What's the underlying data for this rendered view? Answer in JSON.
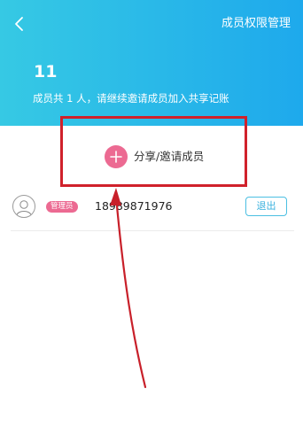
{
  "header": {
    "title": "成员权限管理",
    "member_count": "11",
    "summary": "成员共 1 人，请继续邀请成员加入共享记账"
  },
  "share": {
    "label": "分享/邀请成员"
  },
  "members": [
    {
      "role": "管理员",
      "phone": "18989871976",
      "action": "退出"
    }
  ],
  "icons": {
    "back": "chevron-left-icon",
    "add": "plus-icon",
    "avatar": "user-avatar-icon"
  },
  "colors": {
    "header_gradient_start": "#36c9e4",
    "header_gradient_end": "#1ea9ec",
    "accent_pink": "#ec6a92",
    "exit_blue": "#3bb2df",
    "annotation_red": "#d0212b"
  }
}
